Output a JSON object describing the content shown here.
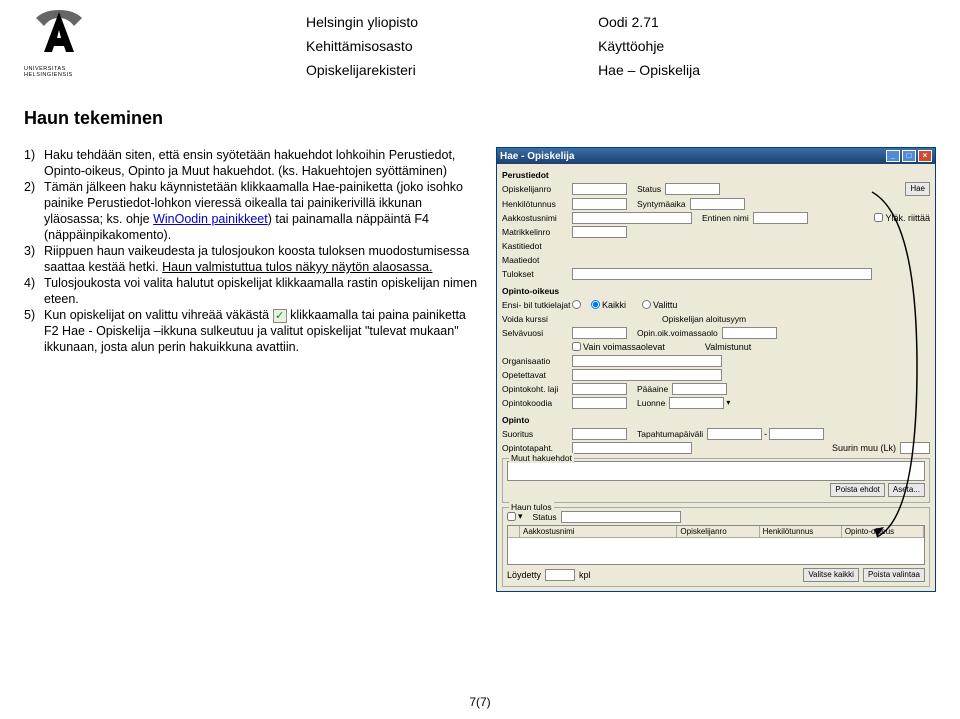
{
  "header": {
    "org1": "Helsingin yliopisto",
    "org2": "Kehittämisosasto",
    "org3": "Opiskelijarekisteri",
    "app1": "Oodi 2.71",
    "app2": "Käyttöohje",
    "app3": "Hae – Opiskelija",
    "logo_caption": "UNIVERSITAS HELSINGIENSIS"
  },
  "title": "Haun tekeminen",
  "steps": [
    {
      "n": "1)",
      "text": "Haku tehdään siten, että ensin syötetään hakuehdot lohkoihin Perustiedot, Opinto-oikeus, Opinto ja Muut hakuehdot. (ks. Hakuehtojen syöttäminen)"
    },
    {
      "n": "2)",
      "pre": "Tämän jälkeen haku käynnistetään klikkaamalla Hae-painiketta (joko isohko painike Perustiedot-lohkon vieressä oikealla tai painikerivillä ikkunan yläosassa; ks. ohje ",
      "link": "WinOodin painikkeet",
      "post": ") tai painamalla näppäintä F4 (näppäinpikakomento)."
    },
    {
      "n": "3)",
      "p1": "Riippuen haun vaikeudesta ja tulosjoukon koosta tuloksen muodostumisessa saattaa kestää hetki. ",
      "p2": "Haun valmistuttua tulos näkyy näytön alaosassa."
    },
    {
      "n": "4)",
      "text": "Tulosjoukosta voi valita halutut opiskelijat klikkaamalla rastin opiskelijan nimen eteen."
    },
    {
      "n": "5)",
      "pre": "Kun opiskelijat on valittu vihreää väkästä ",
      "post": " klikkaamalla tai paina painiketta F2 Hae - Opiskelija –ikkuna sulkeutuu ja valitut opiskelijat \"tulevat mukaan\" ikkunaan, josta alun perin hakuikkuna avattiin."
    }
  ],
  "window": {
    "title": "Hae - Opiskelija",
    "labels": {
      "perustiedot": "Perustiedot",
      "opiskelijanro": "Opiskelijanro",
      "henkilotunnus": "Henkilötunnus",
      "aakkostusnimi": "Aakkostusnimi",
      "matrikkelinro": "Matrikkelinro",
      "kastitiedot": "Kastitiedot",
      "maatiedot": "Maatiedot",
      "status": "Status",
      "syntymaaika": "Syntymäaika",
      "entinen_nimi": "Entinen nimi",
      "hae": "Hae",
      "ylak_riittaa": "Yläk. riittää",
      "tulokset": "Tulokset",
      "opinto_oikeus": "Opinto-oikeus",
      "ensi_bitutkielajat": "Ensi- bil tutkielajat",
      "kaikki": "Kaikki",
      "valittu": "Valittu",
      "voida_kurssi": "Voida kurssi",
      "opiskelijan_aloitusyym": "Opiskelijan aloitusyym",
      "selvavuosi": "Selvävuosi",
      "opin_oik_voimassaolo": "Opin.oik.voimassaolo",
      "vain_voimassaolevat": "Vain voimassaolevat",
      "valmistunut": "Valmistunut",
      "organisaatio": "Organisaatio",
      "opetettavat": "Opetettavat",
      "opintokoht_laji": "Opintokoht. laji",
      "opintokoodia": "Opintokoodia",
      "paaaine": "Pääaine",
      "luonne": "Luonne",
      "opinto": "Opinto",
      "suoritus": "Suoritus",
      "tapahtumapaiva": "Tapahtumapäiväli",
      "opintotapaht": "Opintotapaht.",
      "suurin_muu": "Suurin muu (Lk)",
      "muu_hakuehdot": "Muut hakuehdot",
      "poista_ehdot": "Poista ehdot",
      "aseta": "Aseta...",
      "haun_tulos": "Haun tulos",
      "loydetty": "Löydetty",
      "kpl": "kpl",
      "valitse_kaikki": "Valitse kaikki",
      "poista_valintaa": "Poista valintaa",
      "col_aakkostusnimi": "Aakkostusnimi",
      "col_opiskelijanro": "Opiskelijanro",
      "col_henkilotunnus": "Henkilötunnus",
      "col_opinto_oikeus": "Opinto-oikeus"
    }
  },
  "page_num": "7(7)"
}
